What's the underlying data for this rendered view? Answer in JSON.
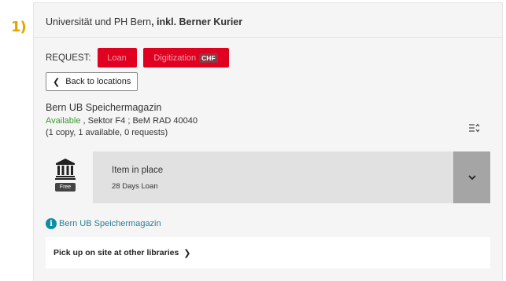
{
  "step": {
    "number": "1)"
  },
  "institution": {
    "name": "Universität und PH Bern",
    "suffix": ", inkl. Berner Kurier"
  },
  "request": {
    "label": "REQUEST:",
    "loan_label": "Loan",
    "digitization_label": "Digitization",
    "chf_badge": "CHF"
  },
  "back_button": {
    "label": "Back to locations",
    "icon": "chevron-left-icon"
  },
  "location": {
    "name": "Bern UB Speichermagazin",
    "status": "Available",
    "details": " , Sektor F4 ; BeM RAD 40040",
    "copies": "(1 copy, 1 available, 0 requests)"
  },
  "sort": {
    "icon": "sort-icon"
  },
  "item": {
    "icon": "library-building-icon",
    "badge": "Free",
    "status": "Item in place",
    "policy": "28 Days Loan",
    "expand_icon": "chevron-down-icon"
  },
  "info": {
    "icon": "info-icon",
    "link_text": "Bern UB Speichermagazin"
  },
  "pickup": {
    "label": "Pick up on site at other libraries",
    "icon": "chevron-right-icon"
  },
  "colors": {
    "accent_red": "#e00020",
    "available_green": "#3c9a2f",
    "info_teal": "#0d8ea3",
    "step_orange": "#e8a200"
  }
}
